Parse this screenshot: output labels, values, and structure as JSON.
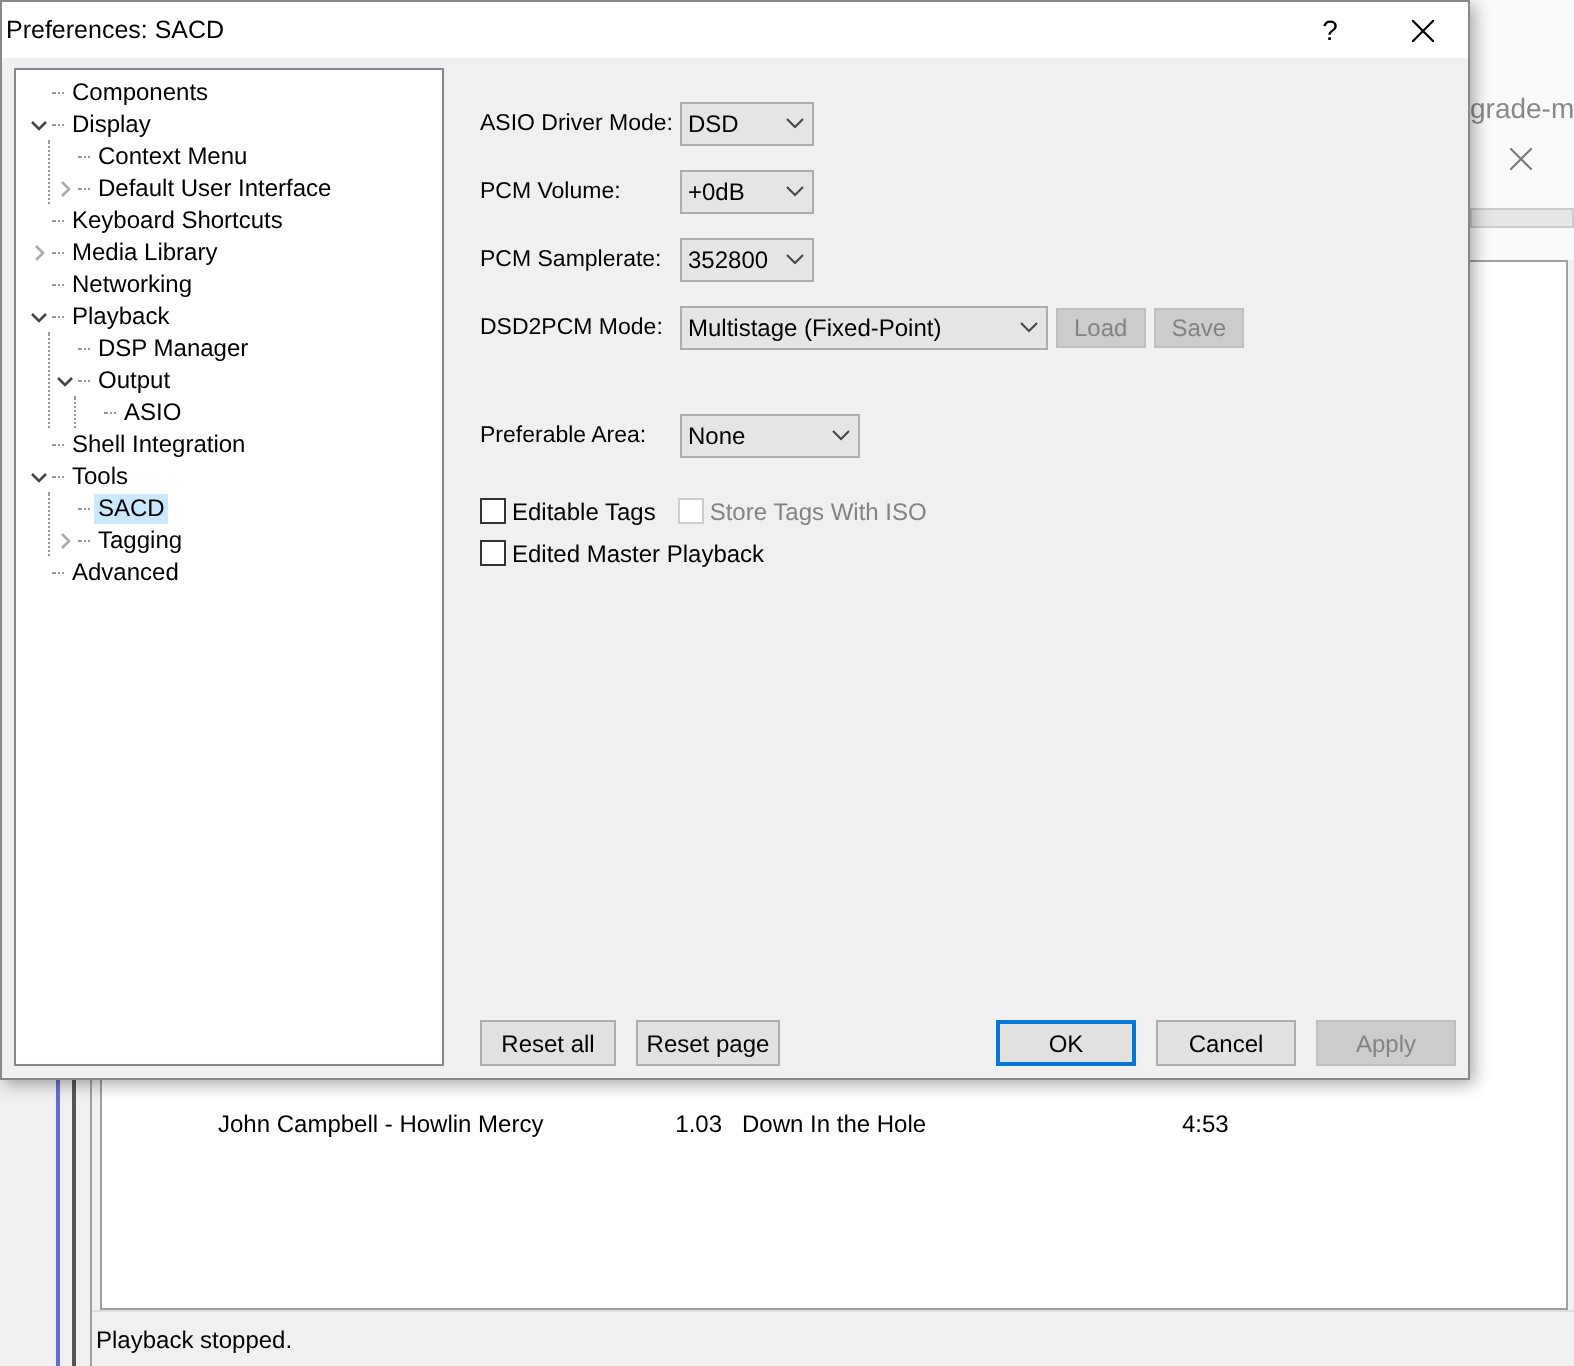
{
  "background_window": {
    "header_text": "grade-m",
    "progress": {
      "level": 0
    },
    "rows": [
      {
        "album": "John Campbell - Howlin Mercy",
        "number": "1.03",
        "title": "Down In the Hole",
        "time": "4:53"
      }
    ],
    "status_bar": "Playback stopped."
  },
  "dialog": {
    "title": "Preferences: SACD",
    "help": "?",
    "tree": [
      {
        "label": "Components",
        "kind": "leaf",
        "selected": false
      },
      {
        "label": "Display",
        "kind": "branch",
        "expanded": true,
        "selected": false,
        "children": [
          {
            "label": "Context Menu",
            "kind": "leaf",
            "selected": false
          },
          {
            "label": "Default User Interface",
            "kind": "branch",
            "expanded": false,
            "selected": false
          }
        ]
      },
      {
        "label": "Keyboard Shortcuts",
        "kind": "leaf",
        "selected": false
      },
      {
        "label": "Media Library",
        "kind": "branch",
        "expanded": false,
        "selected": false
      },
      {
        "label": "Networking",
        "kind": "leaf",
        "selected": false
      },
      {
        "label": "Playback",
        "kind": "branch",
        "expanded": true,
        "selected": false,
        "children": [
          {
            "label": "DSP Manager",
            "kind": "leaf",
            "selected": false
          },
          {
            "label": "Output",
            "kind": "branch",
            "expanded": true,
            "selected": false,
            "children": [
              {
                "label": "ASIO",
                "kind": "leaf",
                "selected": false
              }
            ]
          }
        ]
      },
      {
        "label": "Shell Integration",
        "kind": "leaf",
        "selected": false
      },
      {
        "label": "Tools",
        "kind": "branch",
        "expanded": true,
        "selected": false,
        "children": [
          {
            "label": "SACD",
            "kind": "leaf",
            "selected": true
          },
          {
            "label": "Tagging",
            "kind": "branch",
            "expanded": false,
            "selected": false
          }
        ]
      },
      {
        "label": "Advanced",
        "kind": "leaf",
        "selected": false
      }
    ],
    "settings": [
      {
        "label": "ASIO Driver Mode:",
        "value": "DSD"
      },
      {
        "label": "PCM Volume:",
        "value": "+0dB"
      },
      {
        "label": "PCM Samplerate:",
        "value": "352800"
      },
      {
        "label": "DSD2PCM Mode:",
        "value": "Multistage (Fixed-Point)",
        "buttons": [
          {
            "label": "Load",
            "disabled": true
          },
          {
            "label": "Save",
            "disabled": true
          }
        ]
      }
    ],
    "preferable_area": {
      "label": "Preferable Area:",
      "value": "None"
    },
    "checkbox_rows": [
      [
        {
          "label": "Editable Tags",
          "checked": false,
          "disabled": false
        },
        {
          "label": "Store Tags With ISO",
          "checked": false,
          "disabled": true
        }
      ],
      [
        {
          "label": "Edited Master Playback",
          "checked": false,
          "disabled": false
        }
      ]
    ],
    "left_buttons": [
      {
        "label": "Reset all",
        "default": false,
        "disabled": false
      },
      {
        "label": "Reset page",
        "default": false,
        "disabled": false
      }
    ],
    "right_buttons": [
      {
        "label": "OK",
        "default": true,
        "disabled": false
      },
      {
        "label": "Cancel",
        "default": false,
        "disabled": false
      },
      {
        "label": "Apply",
        "default": false,
        "disabled": true
      }
    ]
  }
}
